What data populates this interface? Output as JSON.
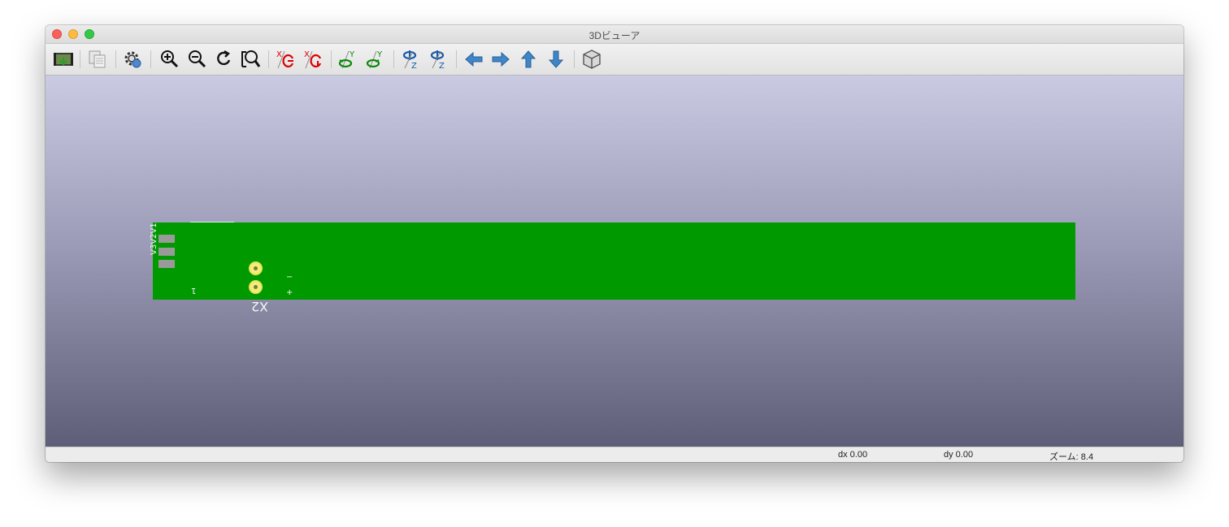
{
  "window": {
    "title": "3Dビューア"
  },
  "toolbar": {
    "buttons": [
      {
        "name": "export-image-icon"
      },
      {
        "name": "copy-image-icon"
      },
      {
        "name": "render-settings-icon"
      },
      {
        "name": "zoom-in-icon"
      },
      {
        "name": "zoom-out-icon"
      },
      {
        "name": "redraw-icon"
      },
      {
        "name": "zoom-fit-icon"
      },
      {
        "name": "rotate-x-cw-icon"
      },
      {
        "name": "rotate-x-ccw-icon"
      },
      {
        "name": "rotate-y-cw-icon"
      },
      {
        "name": "rotate-y-ccw-icon"
      },
      {
        "name": "rotate-z-cw-icon"
      },
      {
        "name": "rotate-z-ccw-icon"
      },
      {
        "name": "pan-left-icon"
      },
      {
        "name": "pan-right-icon"
      },
      {
        "name": "pan-up-icon"
      },
      {
        "name": "pan-down-icon"
      },
      {
        "name": "ortho-view-icon"
      }
    ]
  },
  "pcb": {
    "silkscreen_pins": "V3V2V1",
    "silkscreen_left": "1",
    "ref": "X2",
    "minus": "−",
    "plus": "+",
    "board_color": "#009900",
    "via_color": "#f2ee7a"
  },
  "status": {
    "dx": "dx 0.00",
    "dy": "dy 0.00",
    "zoom": "ズーム: 8.4"
  }
}
